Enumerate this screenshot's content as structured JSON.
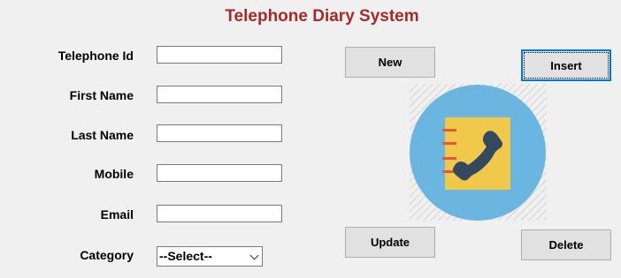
{
  "window": {
    "title": "Telephone Diary System"
  },
  "form": {
    "telephone_id_label": "Telephone Id",
    "first_name_label": "First Name",
    "last_name_label": "Last Name",
    "mobile_label": "Mobile",
    "email_label": "Email",
    "category_label": "Category",
    "telephone_id_value": "",
    "first_name_value": "",
    "last_name_value": "",
    "mobile_value": "",
    "email_value": "",
    "category_selected": "--Select--"
  },
  "buttons": {
    "new": "New",
    "insert": "Insert",
    "update": "Update",
    "delete": "Delete"
  },
  "icons": {
    "logo": "phone-book-icon"
  },
  "colors": {
    "title": "#a52a2a",
    "logo_circle": "#6bb6e0",
    "notebook": "#f0c84a",
    "phone": "#34495e",
    "binding": "#e4573d"
  }
}
